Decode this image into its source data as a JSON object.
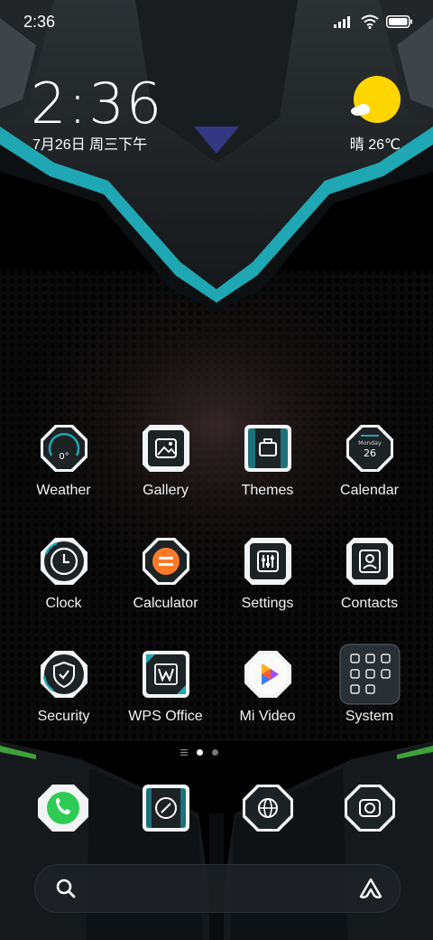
{
  "status_bar": {
    "time": "2:36"
  },
  "clock_widget": {
    "time": "2:36",
    "date": "7月26日 周三下午"
  },
  "weather_widget": {
    "text": "晴 26℃"
  },
  "apps": [
    {
      "label": "Weather",
      "icon": "weather-icon",
      "icon_text": "0°"
    },
    {
      "label": "Gallery",
      "icon": "gallery-icon"
    },
    {
      "label": "Themes",
      "icon": "themes-icon"
    },
    {
      "label": "Calendar",
      "icon": "calendar-icon",
      "icon_text_top": "Monday",
      "icon_text_bottom": "26"
    },
    {
      "label": "Clock",
      "icon": "clock-icon"
    },
    {
      "label": "Calculator",
      "icon": "calculator-icon"
    },
    {
      "label": "Settings",
      "icon": "settings-icon"
    },
    {
      "label": "Contacts",
      "icon": "contacts-icon"
    },
    {
      "label": "Security",
      "icon": "security-icon"
    },
    {
      "label": "WPS Office",
      "icon": "wps-office-icon"
    },
    {
      "label": "Mi Video",
      "icon": "mi-video-icon"
    },
    {
      "label": "System",
      "icon": "system-folder-icon"
    }
  ],
  "dock": [
    {
      "icon": "phone-icon"
    },
    {
      "icon": "compass-icon"
    },
    {
      "icon": "browser-icon"
    },
    {
      "icon": "camera-icon"
    }
  ],
  "pager": {
    "pages": 2,
    "current": 1
  },
  "colors": {
    "accent": "#1fa7b3",
    "sun": "#ffd600",
    "phone": "#2ecc55",
    "calculator": "#ff7a28"
  }
}
